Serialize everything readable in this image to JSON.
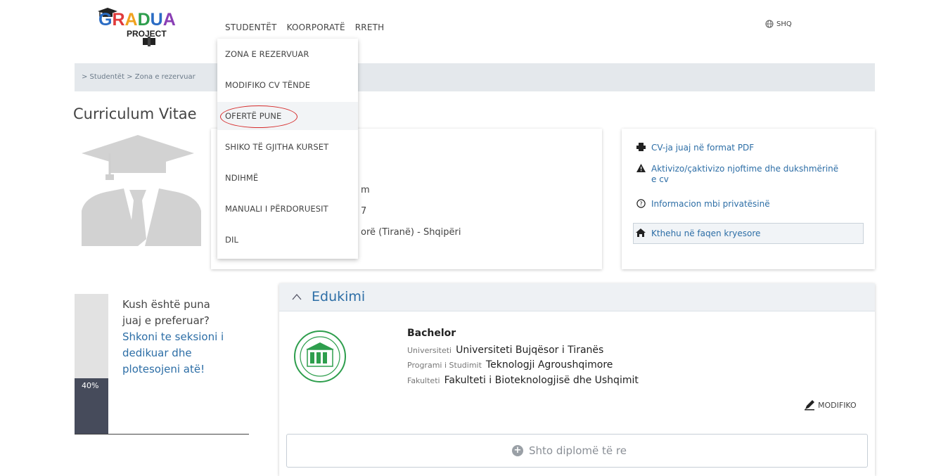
{
  "logo": {
    "brand": "GRADUA",
    "sub": "PROJECT"
  },
  "nav": {
    "items": [
      "STUDENTËT",
      "KOORPORATË",
      "RRETH"
    ],
    "lang": "SHQ"
  },
  "breadcrumb": "> Studentët > Zona e rezervuar",
  "page_title": "Curriculum Vitae",
  "dropdown": {
    "items": [
      "ZONA E REZERVUAR",
      "MODIFIKO CV TËNDE",
      "OFERTË PUNE",
      "SHIKO TË GJITHA KURSET",
      "NDIHMË",
      "MANUALI I PËRDORUESIT",
      "DIL"
    ],
    "highlighted": "OFERTË PUNE"
  },
  "contact": {
    "email_fragment": "m",
    "phone_fragment": "7",
    "location_fragment": "orë (Tiranë) - Shqipëri"
  },
  "actions": {
    "pdf": "CV-ja juaj në format PDF",
    "notify_line1": "Aktivizo/çaktivizo njoftime dhe dukshmërinë",
    "notify_line2": "e cv",
    "privacy": "Informacion mbi privatësinë",
    "home": "Kthehu në faqen kryesore"
  },
  "progress": {
    "percent_label": "40%",
    "percent_value": 40,
    "question_line1": "Kush është puna",
    "question_line2": "juaj e preferuar?",
    "link_line1": "Shkoni te seksioni i",
    "link_line2": "dedikuar dhe",
    "link_line3": "plotesojeni atë!"
  },
  "education": {
    "section_title": "Edukimi",
    "degree": "Bachelor",
    "university_label": "Universiteti",
    "university": "Universiteti Bujqësor i Tiranës",
    "program_label": "Programi i Studimit",
    "program": "Teknologji Agroushqimore",
    "faculty_label": "Fakulteti",
    "faculty": "Fakulteti i Bioteknologjisë dhe Ushqimit",
    "edit_label": "MODIFIKO",
    "add_label": "Shto diplomë të re"
  },
  "colors": {
    "link": "#2d6ea6",
    "progress_fill": "#464b5b",
    "highlight_ring": "#d62b2b",
    "seal": "#2e9e4d"
  }
}
